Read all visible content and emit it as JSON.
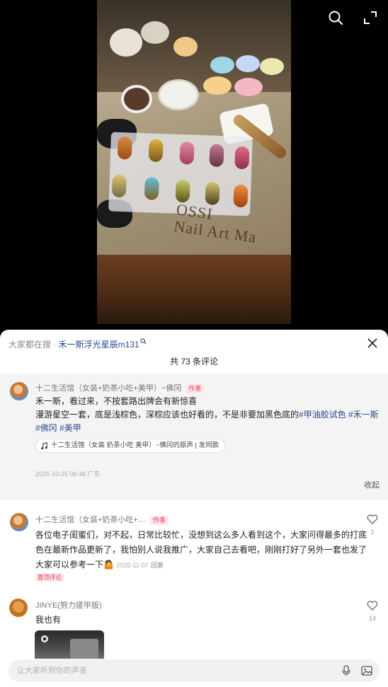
{
  "video": {
    "overlay_text": "OSSI\nNail Art Ma",
    "icons": {
      "search": "search-icon",
      "expand": "expand-icon"
    }
  },
  "sheet": {
    "search_prefix": "大家都在搜 · ",
    "search_keyword": "禾一斯浮光星辰m131",
    "comment_count_label": "共 73 条评论",
    "close_icon": "close-icon"
  },
  "pinned_comment": {
    "username": "十二生活馆（女装+奶茶小吃+美甲）~佛冈",
    "author_tag": "作者",
    "line1": "禾一斯，看过来，不按套路出牌会有新惊喜",
    "line2_text": "漫游星空一套，底是浅棕色，深棕应该也好看的，不是非要加黑色底的",
    "hashtags": [
      "#甲油胶试色",
      "#禾一斯",
      "#佛冈",
      "#美甲"
    ],
    "music_label": "十二生活馆（女装 奶茶小吃 美甲）~佛冈的原声 | 发同款",
    "timestamp": "2025-10-25 06:48 广东",
    "collapse_label": "收起"
  },
  "comments": [
    {
      "username": "十二生活馆（女装+奶茶小吃+…",
      "author_tag": "作者",
      "text_l1": "各位电子闺蜜们，对不起，日常比较忙，没想到这么多人看到这个，大家问得最多的打底",
      "text_l2": "色在最新作品更新了，我怕别人说我推广，大家自己去看吧，刚刚打好了另外一套也发了",
      "text_l3": "大家可以参考一下",
      "emoji": "🤷",
      "date": "2025-11-07",
      "reply_label": "回复",
      "badge": "置顶评论",
      "likes": "1"
    },
    {
      "username": "JINYE(努力搓甲版)",
      "text": "我也有",
      "likes": "14"
    }
  ],
  "input": {
    "placeholder": "让大家听到你的声音",
    "mic_icon": "mic-icon",
    "image_icon": "image-icon"
  },
  "colors": {
    "link": "#2a4a8a",
    "author_tag": "#e0475f",
    "pinned_bg": "#f4f4f4"
  }
}
